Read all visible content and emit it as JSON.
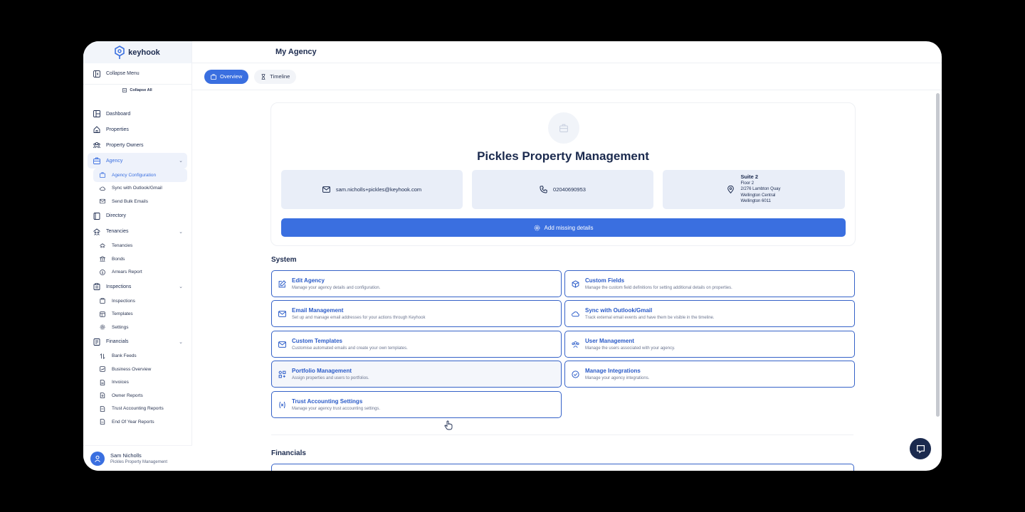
{
  "brand": {
    "name": "keyhook"
  },
  "sidebar": {
    "collapse_menu": "Collapse Menu",
    "collapse_all": "Collapse All",
    "items": [
      {
        "label": "Dashboard",
        "icon": "dashboard-icon"
      },
      {
        "label": "Properties",
        "icon": "home-icon"
      },
      {
        "label": "Property Owners",
        "icon": "users-icon"
      },
      {
        "label": "Agency",
        "icon": "briefcase-icon",
        "active": true,
        "expanded": true,
        "children": [
          {
            "label": "Agency Configuration",
            "icon": "briefcase-icon",
            "active": true
          },
          {
            "label": "Sync with Outlook/Gmail",
            "icon": "cloud-icon"
          },
          {
            "label": "Send Bulk Emails",
            "icon": "mail-icon"
          }
        ]
      },
      {
        "label": "Directory",
        "icon": "book-icon"
      },
      {
        "label": "Tenancies",
        "icon": "tenancies-icon",
        "expanded": true,
        "children": [
          {
            "label": "Tenancies",
            "icon": "tenancies-icon"
          },
          {
            "label": "Bonds",
            "icon": "bank-icon"
          },
          {
            "label": "Arrears Report",
            "icon": "dollar-icon"
          }
        ]
      },
      {
        "label": "Inspections",
        "icon": "clipboard-icon",
        "expanded": true,
        "children": [
          {
            "label": "Inspections",
            "icon": "clipboard-icon"
          },
          {
            "label": "Templates",
            "icon": "template-icon"
          },
          {
            "label": "Settings",
            "icon": "gear-icon"
          }
        ]
      },
      {
        "label": "Financials",
        "icon": "ledger-icon",
        "expanded": true,
        "children": [
          {
            "label": "Bank Feeds",
            "icon": "transfer-icon"
          },
          {
            "label": "Business Overview",
            "icon": "chart-icon"
          },
          {
            "label": "Invoices",
            "icon": "invoice-icon"
          },
          {
            "label": "Owner Reports",
            "icon": "report-icon"
          },
          {
            "label": "Trust Accounting Reports",
            "icon": "report-icon"
          },
          {
            "label": "End Of Year Reports",
            "icon": "report-icon"
          }
        ]
      }
    ]
  },
  "user": {
    "name": "Sam Nicholls",
    "org": "Pickles Property Management"
  },
  "header": {
    "title": "My Agency"
  },
  "tabs": [
    {
      "label": "Overview",
      "active": true
    },
    {
      "label": "Timeline",
      "active": false
    }
  ],
  "agency": {
    "name": "Pickles Property Management",
    "email": "sam.nicholls+pickles@keyhook.com",
    "phone": "02040690953",
    "address": {
      "line1": "Suite 2",
      "line2": "Floor 2",
      "line3": "2/276 Lambton Quay",
      "line4": "Wellington Central",
      "line5": "Wellington 6011"
    },
    "add_missing_label": "Add missing details"
  },
  "system": {
    "title": "System",
    "cards": [
      {
        "title": "Edit Agency",
        "desc": "Manage your agency details and configuration.",
        "icon": "edit-icon"
      },
      {
        "title": "Custom Fields",
        "desc": "Manage the custom field definitions for setting additional details on properties.",
        "icon": "cube-icon"
      },
      {
        "title": "Email Management",
        "desc": "Set up and manage email addresses for your actions through Keyhook",
        "icon": "mail-icon"
      },
      {
        "title": "Sync with Outlook/Gmail",
        "desc": "Track external email events and have them be visible in the timeline.",
        "icon": "cloud-icon"
      },
      {
        "title": "Custom Templates",
        "desc": "Customise automated emails and create your own templates.",
        "icon": "mail-icon"
      },
      {
        "title": "User Management",
        "desc": "Manage the users associated with your agency.",
        "icon": "users-icon"
      },
      {
        "title": "Portfolio Management",
        "desc": "Assign properties and users to portfolios.",
        "icon": "portfolio-icon"
      },
      {
        "title": "Manage Integrations",
        "desc": "Manage your agency integrations.",
        "icon": "check-circle-icon"
      },
      {
        "title": "Trust Accounting Settings",
        "desc": "Manage your agency trust accounting settings.",
        "icon": "variable-icon"
      }
    ]
  },
  "financials": {
    "title": "Financials"
  },
  "colors": {
    "accent": "#3a6fe0",
    "navy": "#1b2a4e",
    "card_border": "#3562c8"
  }
}
